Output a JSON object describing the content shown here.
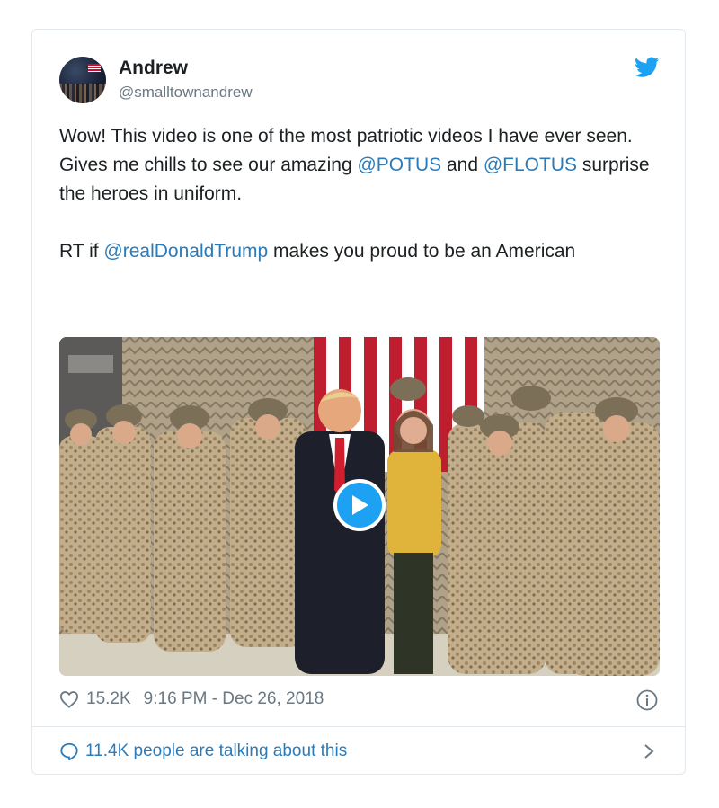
{
  "tweet": {
    "author": {
      "name": "Andrew",
      "handle": "@smalltownandrew"
    },
    "text": {
      "line1_pre": "Wow! This video is one of the most patriotic videos I have ever seen. Gives me chills to see our amazing ",
      "mention_potus": "@POTUS",
      "line1_mid": " and ",
      "mention_flotus": "@FLOTUS",
      "line1_post": " surprise the heroes in uniform.",
      "line2_pre": "RT if ",
      "mention_trump": "@realDonaldTrump",
      "line2_post": " makes you proud to be an American"
    },
    "likes": "15.2K",
    "timestamp": "9:16 PM - Dec 26, 2018",
    "conversation": "11.4K people are talking about this"
  },
  "colors": {
    "link": "#2b7bb9",
    "twitter_blue": "#1da1f2",
    "muted": "#697882",
    "border": "#e1e8ed"
  },
  "icons": [
    "twitter-bird-icon",
    "heart-icon",
    "info-icon",
    "speech-bubble-icon",
    "chevron-right-icon",
    "play-icon"
  ]
}
